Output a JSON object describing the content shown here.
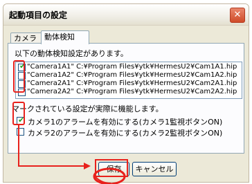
{
  "dialog": {
    "title": "起動項目の設定",
    "close_glyph": "✕"
  },
  "tabs": [
    {
      "label": "カメラ"
    },
    {
      "label": "動体検知"
    }
  ],
  "panel": {
    "heading": "以下の動体検知設定があります。",
    "rows": [
      {
        "text": "\"Camera1A1\" C:¥Program Files¥ytk¥HermesU2¥Cam1A1.hip",
        "checked": true
      },
      {
        "text": "\"Camera1A2\" C:¥Program Files¥ytk¥HermesU2¥Cam1A2.hip",
        "checked": false
      },
      {
        "text": "\"Camera2A1\" C:¥Program Files¥ytk¥HermesU2¥Cam2A1.hip",
        "checked": false
      },
      {
        "text": "\"Camera2A2\" C:¥Program Files¥ytk¥HermesU2¥Cam2A2.hip",
        "checked": false
      }
    ],
    "note": "マークされている設定が実際に機能します。",
    "options": [
      {
        "text": "カメラ1のアラームを有効にする(カメラ1監視ボタンON)",
        "checked": true
      },
      {
        "text": "カメラ2のアラームを有効にする(カメラ2監視ボタンON)",
        "checked": false
      }
    ]
  },
  "buttons": {
    "save": "保存",
    "cancel": "キャンセル"
  },
  "colors": {
    "annotation": "#e8211c",
    "check": "#21a121"
  }
}
